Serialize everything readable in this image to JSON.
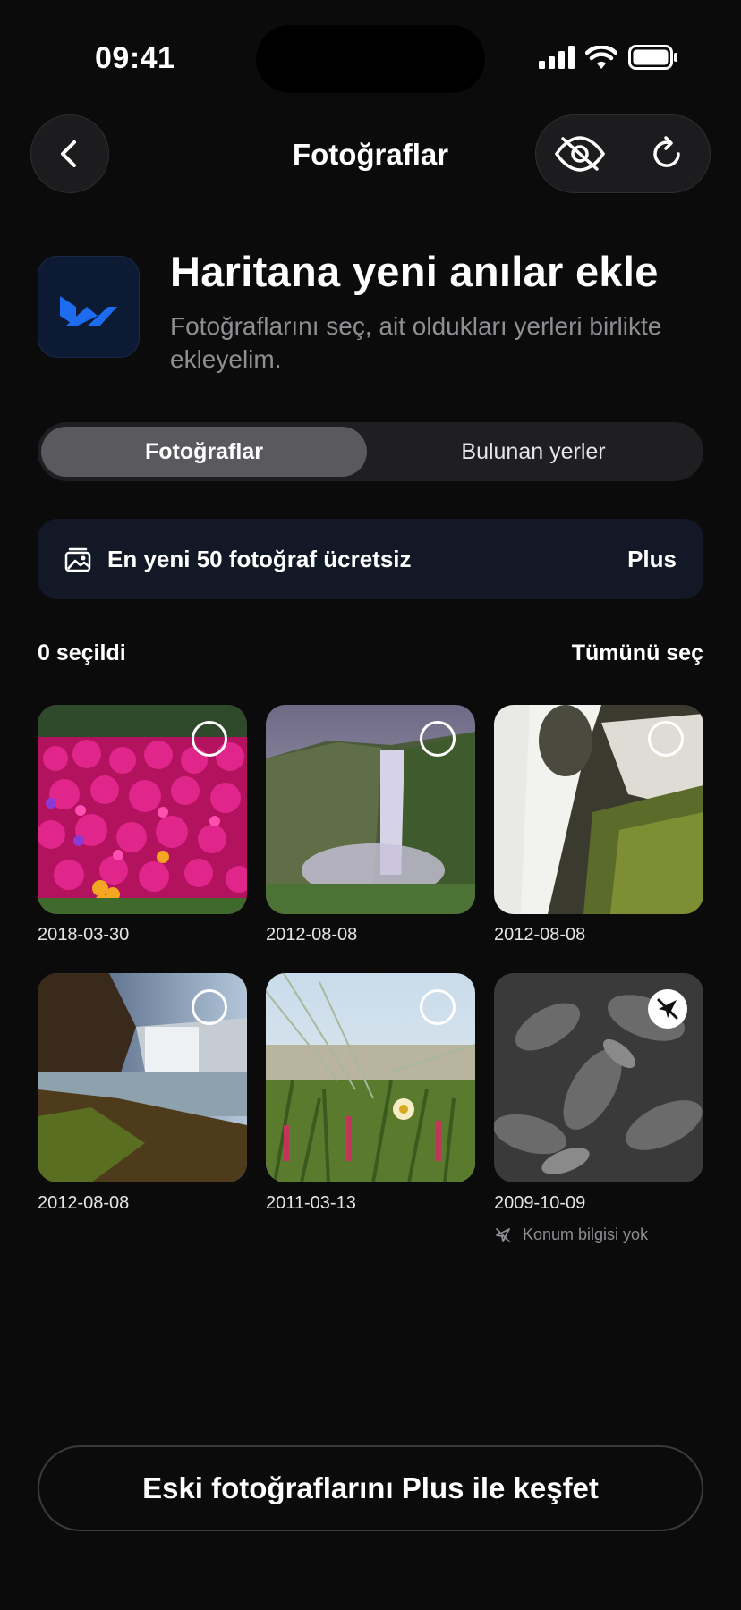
{
  "status": {
    "time": "09:41"
  },
  "header": {
    "title": "Fotoğraflar"
  },
  "intro": {
    "title": "Haritana yeni anılar ekle",
    "subtitle": "Fotoğraflarını seç, ait oldukları yerleri birlikte ekleyelim."
  },
  "tabs": {
    "active": "Fotoğraflar",
    "inactive": "Bulunan yerler"
  },
  "banner": {
    "text": "En yeni 50 fotoğraf ücretsiz",
    "badge": "Plus"
  },
  "selection": {
    "count_label": "0 seçildi",
    "select_all": "Tümünü seç"
  },
  "photos": [
    {
      "date": "2018-03-30",
      "subject": "flowers",
      "selected": false
    },
    {
      "date": "2012-08-08",
      "subject": "waterfall-cliff",
      "selected": false
    },
    {
      "date": "2012-08-08",
      "subject": "waterfall-rocks",
      "selected": false
    },
    {
      "date": "2012-08-08",
      "subject": "waterfall-canyon",
      "selected": false
    },
    {
      "date": "2011-03-13",
      "subject": "grass-flower",
      "selected": false
    },
    {
      "date": "2009-10-09",
      "subject": "leaves-bw",
      "selected": false,
      "no_location": true,
      "no_location_label": "Konum bilgisi yok"
    }
  ],
  "cta": {
    "label": "Eski fotoğraflarını Plus ile keşfet"
  },
  "colors": {
    "background": "#0b0b0b",
    "banner": "#121826",
    "accent": "#1d6cf0",
    "muted": "#8e8e93"
  }
}
